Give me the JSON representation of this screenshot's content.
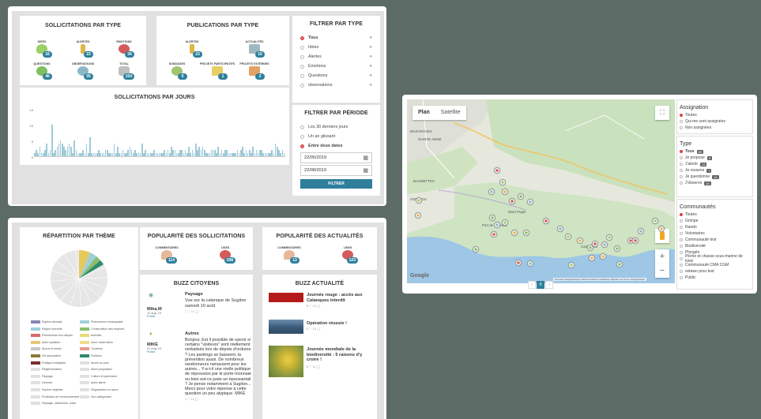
{
  "solicitations_by_type": {
    "title": "SOLLICITATIONS PAR TYPE",
    "items": [
      {
        "label": "IDÉES",
        "count": "16",
        "icon": "lightbulb-icon"
      },
      {
        "label": "ALERTES",
        "count": "23",
        "icon": "exclamation-icon"
      },
      {
        "label": "ÉMOTIONS",
        "count": "34",
        "icon": "heart-icon"
      },
      {
        "label": "QUESTIONS",
        "count": "46",
        "icon": "question-icon"
      },
      {
        "label": "OBSERVATIONS",
        "count": "55",
        "icon": "eye-icon"
      },
      {
        "label": "TOTAL",
        "count": "154",
        "icon": "total-icon"
      }
    ]
  },
  "publications_by_type": {
    "title": "PUBLICATIONS PAR TYPE",
    "items": [
      {
        "label": "ALERTES",
        "count": "23",
        "icon": "exclamation-icon"
      },
      {
        "label": "ACTUALITÉS",
        "count": "10",
        "icon": "news-icon"
      },
      {
        "label": "SONDAGES",
        "count": "0",
        "icon": "poll-icon"
      },
      {
        "label": "PROJETS PARTICIPATIFS",
        "count": "1",
        "icon": "puzzle-icon"
      },
      {
        "label": "PROJETS EXTERNES",
        "count": "2",
        "icon": "external-project-icon"
      }
    ]
  },
  "filter_type": {
    "title": "FILTRER PAR TYPE",
    "options": [
      {
        "label": "Tous",
        "selected": true,
        "icon": "all-icon"
      },
      {
        "label": "Idées",
        "selected": false,
        "icon": "lightbulb-icon"
      },
      {
        "label": "Alertes",
        "selected": false,
        "icon": "exclamation-icon"
      },
      {
        "label": "Émotions",
        "selected": false,
        "icon": "heart-icon"
      },
      {
        "label": "Questions",
        "selected": false,
        "icon": "question-icon"
      },
      {
        "label": "observations",
        "selected": false,
        "icon": "eye-icon"
      }
    ]
  },
  "filter_period": {
    "title": "FILTRER PAR PÉRIODE",
    "options": [
      {
        "label": "Les 30 derniers jours",
        "selected": false
      },
      {
        "label": "Un an glissant",
        "selected": false
      },
      {
        "label": "Entre deux dates",
        "selected": true
      }
    ],
    "date_from": "22/05/2019",
    "date_to": "22/08/2019",
    "button": "FILTRER"
  },
  "chart_data": {
    "type": "bar",
    "title": "SOLLICITATIONS PAR JOURS",
    "ylim": [
      0,
      15
    ],
    "yticks": [
      "15",
      "10",
      "5",
      "0"
    ],
    "values": [
      1,
      2,
      1,
      3,
      1,
      1,
      2,
      4,
      1,
      2,
      10,
      1,
      2,
      3,
      4,
      5,
      4,
      3,
      2,
      3,
      4,
      3,
      1,
      5,
      2,
      1,
      1,
      1,
      2,
      1,
      4,
      1,
      6,
      1,
      1,
      1,
      1,
      2,
      1,
      1,
      1,
      2,
      2,
      1,
      1,
      1,
      4,
      1,
      3,
      1,
      1,
      2,
      1,
      1,
      2,
      3,
      2,
      1,
      2,
      1,
      1,
      1,
      4,
      1,
      2,
      1,
      1,
      1,
      1,
      2,
      1,
      1,
      1,
      1,
      1,
      2,
      1,
      2,
      1,
      3,
      2,
      2,
      1,
      1,
      2,
      2,
      1,
      2,
      1,
      3,
      1,
      2,
      1,
      4,
      2,
      3,
      2,
      3,
      2,
      1,
      1,
      1,
      2,
      2,
      2,
      1,
      3,
      1,
      2,
      1,
      2,
      2,
      1,
      1,
      1,
      1,
      1,
      2,
      1,
      2,
      3,
      1,
      2,
      1,
      2,
      1,
      3,
      1,
      2,
      1,
      2,
      2,
      1,
      1,
      1,
      1,
      1,
      2,
      1,
      4,
      3,
      2,
      1,
      2,
      1
    ]
  },
  "theme_chart": {
    "title": "RÉPARTITION PAR THÈME",
    "legend": [
      {
        "label": "Espèce animale",
        "color": "#8a86b5"
      },
      {
        "label": "Phénomène remarquable",
        "color": "#9fd0d8"
      },
      {
        "label": "Risque incendie",
        "color": "#9fd0d8"
      },
      {
        "label": "Conservation des espèces",
        "color": "#8bbd6f"
      },
      {
        "label": "Événements éco-citoyen",
        "color": "#d96a6a"
      },
      {
        "label": "Activités",
        "color": "#e9d877"
      },
      {
        "label": "Autre question",
        "color": "#e0ca7a"
      },
      {
        "label": "Autre observation",
        "color": "#f0dc8c"
      },
      {
        "label": "Sports et loisirs",
        "color": "#c7c7c7"
      },
      {
        "label": "Tourisme",
        "color": "#e39b8a"
      },
      {
        "label": "Vie associative",
        "color": "#8d7a3a"
      },
      {
        "label": "Pollution",
        "color": "#2e8b6a"
      },
      {
        "label": "Pratique inadaptée",
        "color": "#7a2e2e"
      },
      {
        "label": "Accès au parc",
        "color": "#e0e0e0"
      },
      {
        "label": "Réglementation",
        "color": "#e0e0e0"
      },
      {
        "label": "Autre proposition",
        "color": "#e0e0e0"
      },
      {
        "label": "Paysage",
        "color": "#e0e0e0"
      },
      {
        "label": "Culture et patrimoine",
        "color": "#e0e0e0"
      },
      {
        "label": "Déchets",
        "color": "#e0e0e0"
      },
      {
        "label": "Autre alerte",
        "color": "#e0e0e0"
      },
      {
        "label": "Espèce végétale",
        "color": "#e0e0e0"
      },
      {
        "label": "Dégradation ou usure",
        "color": "#e0e0e0"
      },
      {
        "label": "Protection de l'environnement",
        "color": "#e0e0e0"
      },
      {
        "label": "Non catégorisés",
        "color": "#e0e0e0"
      },
      {
        "label": "Paysage, urbanisme, voirie",
        "color": "#e0e0e0"
      }
    ]
  },
  "popularity_solicitations": {
    "title": "POPULARITÉ DES SOLLICITATIONS",
    "comments_label": "COMMENTAIRES",
    "comments": "114",
    "likes_label": "LIKES",
    "likes": "298"
  },
  "popularity_news": {
    "title": "POPULARITÉ DES ACTUALITÉS",
    "comments_label": "COMMENTAIRES",
    "comments": "13",
    "likes_label": "LIKES",
    "likes": "123"
  },
  "buzz_citizens": {
    "title": "BUZZ CITOYENS",
    "items": [
      {
        "author": "Mika.M",
        "date": "12 aug. 19",
        "visibility": "Public",
        "heading": "Paysage",
        "text": "Vue sur la calanque de Sugiton samedi 10 août",
        "stats": "7 ♡  11 ◯"
      },
      {
        "author": "MIKE",
        "date": "21 may 19",
        "visibility": "Public",
        "heading": "Autres",
        "text": "Bonjour, Est il possible de savoir si certains \"visiteurs\" sont réellement verbalisés lors de dépots d'ordures ? Les parkings se baissent, la prévention aussi. De nombreux randonneurs ramassent pour les autres... Y-a-t-il une réelle politique de répression par le porte-monnaie ou bien est-ce juste un épouvantail ? Je pense notamment à Sugiton... Merci pour votre réponse à cette question un peu atypique. MIKE",
        "stats": "1 ♡  11 ◯"
      }
    ]
  },
  "buzz_news": {
    "title": "BUZZ ACTUALITÉ",
    "items": [
      {
        "heading": "Journée rouge : accès aux Calanques interdit",
        "stats": "8 ♡  10 ◯"
      },
      {
        "heading": "Opération réussie !",
        "stats": "8 ♡  10 ◯"
      },
      {
        "heading": "Journée mondiale de la biodiversité : 5 raisons d'y croire !",
        "stats": "8 ♡  11 ◯"
      }
    ]
  },
  "map": {
    "tab_plan": "Plan",
    "tab_satellite": "Satellite",
    "google": "Google",
    "attribution": "Données cartographiques ©2019   Conditions d'utilisation   Signaler une erreur cartographique",
    "places": [
      "MAZARGUES",
      "SAINTE-ANNE",
      "BAUMETTES",
      "SORMIOU",
      "Mont Puget",
      "Port de Sormiou",
      "Calanques"
    ],
    "pager": [
      "‹",
      "0",
      "›"
    ]
  },
  "map_filters": {
    "assignment_title": "Assignation",
    "assignment": [
      {
        "label": "Toutes",
        "selected": true
      },
      {
        "label": "Qui me sont assignées",
        "selected": false
      },
      {
        "label": "Non assignées",
        "selected": false
      }
    ],
    "type_title": "Type",
    "types": [
      {
        "label": "Tous",
        "count": "89",
        "selected": true
      },
      {
        "label": "Je propose",
        "count": "5",
        "selected": false
      },
      {
        "label": "J'alerte",
        "count": "23",
        "selected": false
      },
      {
        "label": "Je ressens",
        "count": "7",
        "selected": false
      },
      {
        "label": "Je questionne",
        "count": "14",
        "selected": false
      },
      {
        "label": "J'observe",
        "count": "24",
        "selected": false
      }
    ],
    "community_title": "Communautés",
    "communities": [
      {
        "label": "Toutes",
        "selected": true
      },
      {
        "label": "Grimpe",
        "selected": false
      },
      {
        "label": "Rando",
        "selected": false
      },
      {
        "label": "Volontaires",
        "selected": false
      },
      {
        "label": "Communauté test",
        "selected": false
      },
      {
        "label": "Biodiversité",
        "selected": false
      },
      {
        "label": "Plongée",
        "selected": false
      },
      {
        "label": "Pêche et chasse sous-marine de loisir",
        "selected": false
      },
      {
        "label": "Communauté CMA CGM",
        "selected": false
      },
      {
        "label": "setawo pour test",
        "selected": false
      },
      {
        "label": "Public",
        "selected": false
      }
    ]
  }
}
